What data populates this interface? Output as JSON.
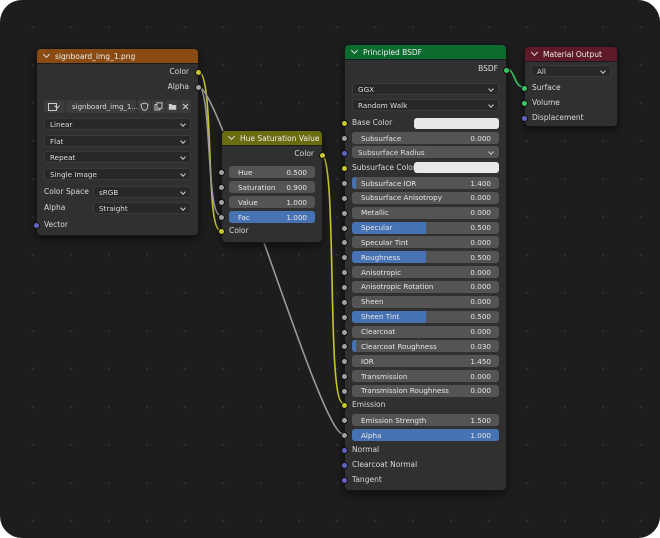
{
  "image_node": {
    "title": "signboard_img_1.png",
    "header_color": "#8a4b12",
    "outputs": [
      "Color",
      "Alpha"
    ],
    "image_name": "signboard_img_1....",
    "dropdowns": [
      "Linear",
      "Flat",
      "Repeat",
      "Single Image"
    ],
    "color_space_label": "Color Space",
    "color_space_value": "sRGB",
    "alpha_label": "Alpha",
    "alpha_value": "Straight",
    "input": "Vector"
  },
  "hue_node": {
    "title": "Hue Saturation Value",
    "header_color": "#6b6b10",
    "output": "Color",
    "fields": [
      {
        "label": "Hue",
        "value": "0.500",
        "fill": 0
      },
      {
        "label": "Saturation",
        "value": "0.900",
        "fill": 0
      },
      {
        "label": "Value",
        "value": "1.000",
        "fill": 0
      },
      {
        "label": "Fac",
        "value": "1.000",
        "fill": 1
      }
    ],
    "input": "Color"
  },
  "bsdf_node": {
    "title": "Principled BSDF",
    "header_color": "#0c6b2f",
    "output": "BSDF",
    "distribution": "GGX",
    "subsurface_method": "Random Walk",
    "base_color_label": "Base Color",
    "subsurface_field": {
      "label": "Subsurface",
      "value": "0.000",
      "fill": 0
    },
    "subsurface_radius": "Subsurface Radius",
    "subsurface_color_label": "Subsurface Color",
    "fields": [
      {
        "label": "Subsurface IOR",
        "value": "1.400",
        "fill": 0.03
      },
      {
        "label": "Subsurface Anisotropy",
        "value": "0.000",
        "fill": 0
      },
      {
        "label": "Metallic",
        "value": "0.000",
        "fill": 0
      },
      {
        "label": "Specular",
        "value": "0.500",
        "fill": 0.5
      },
      {
        "label": "Specular Tint",
        "value": "0.000",
        "fill": 0
      },
      {
        "label": "Roughness",
        "value": "0.500",
        "fill": 0.5
      },
      {
        "label": "Anisotropic",
        "value": "0.000",
        "fill": 0
      },
      {
        "label": "Anisotropic Rotation",
        "value": "0.000",
        "fill": 0
      },
      {
        "label": "Sheen",
        "value": "0.000",
        "fill": 0
      },
      {
        "label": "Sheen Tint",
        "value": "0.500",
        "fill": 0.5
      },
      {
        "label": "Clearcoat",
        "value": "0.000",
        "fill": 0
      },
      {
        "label": "Clearcoat Roughness",
        "value": "0.030",
        "fill": 0.03
      },
      {
        "label": "IOR",
        "value": "1.450",
        "fill": 0
      },
      {
        "label": "Transmission",
        "value": "0.000",
        "fill": 0
      },
      {
        "label": "Transmission Roughness",
        "value": "0.000",
        "fill": 0
      }
    ],
    "emission_label": "Emission",
    "emission_strength": {
      "label": "Emission Strength",
      "value": "1.500",
      "fill": 0
    },
    "alpha": {
      "label": "Alpha",
      "value": "1.000",
      "fill": 1
    },
    "vector_inputs": [
      "Normal",
      "Clearcoat Normal",
      "Tangent"
    ]
  },
  "output_node": {
    "title": "Material Output",
    "header_color": "#5e1a28",
    "target": "All",
    "inputs": [
      "Surface",
      "Volume",
      "Displacement"
    ]
  },
  "colors": {
    "background": "#1d1d1d",
    "node_body": "#303030",
    "field": "#545454",
    "field_fill": "#4772b3",
    "socket_color": "#c7c729",
    "socket_float": "#a1a1a1",
    "socket_vector": "#6363c7",
    "socket_shader": "#38c760"
  }
}
